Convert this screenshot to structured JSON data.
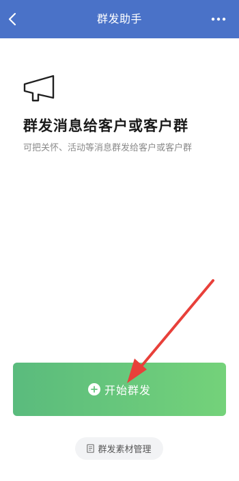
{
  "header": {
    "title": "群发助手",
    "back_icon": "chevron-left-icon",
    "more_icon": "more-dots-icon",
    "background": "#4a72c8"
  },
  "intro": {
    "icon": "megaphone-icon",
    "headline": "群发消息给客户或客户群",
    "description": "可把关怀、活动等消息群发给客户或客户群"
  },
  "actions": {
    "start_label": "开始群发",
    "start_icon": "plus-circle-icon",
    "start_gradient": [
      "#5abb7d",
      "#74d27a"
    ],
    "material_label": "群发素材管理",
    "material_icon": "document-icon"
  },
  "annotation": {
    "arrow_color": "#e8403a"
  }
}
